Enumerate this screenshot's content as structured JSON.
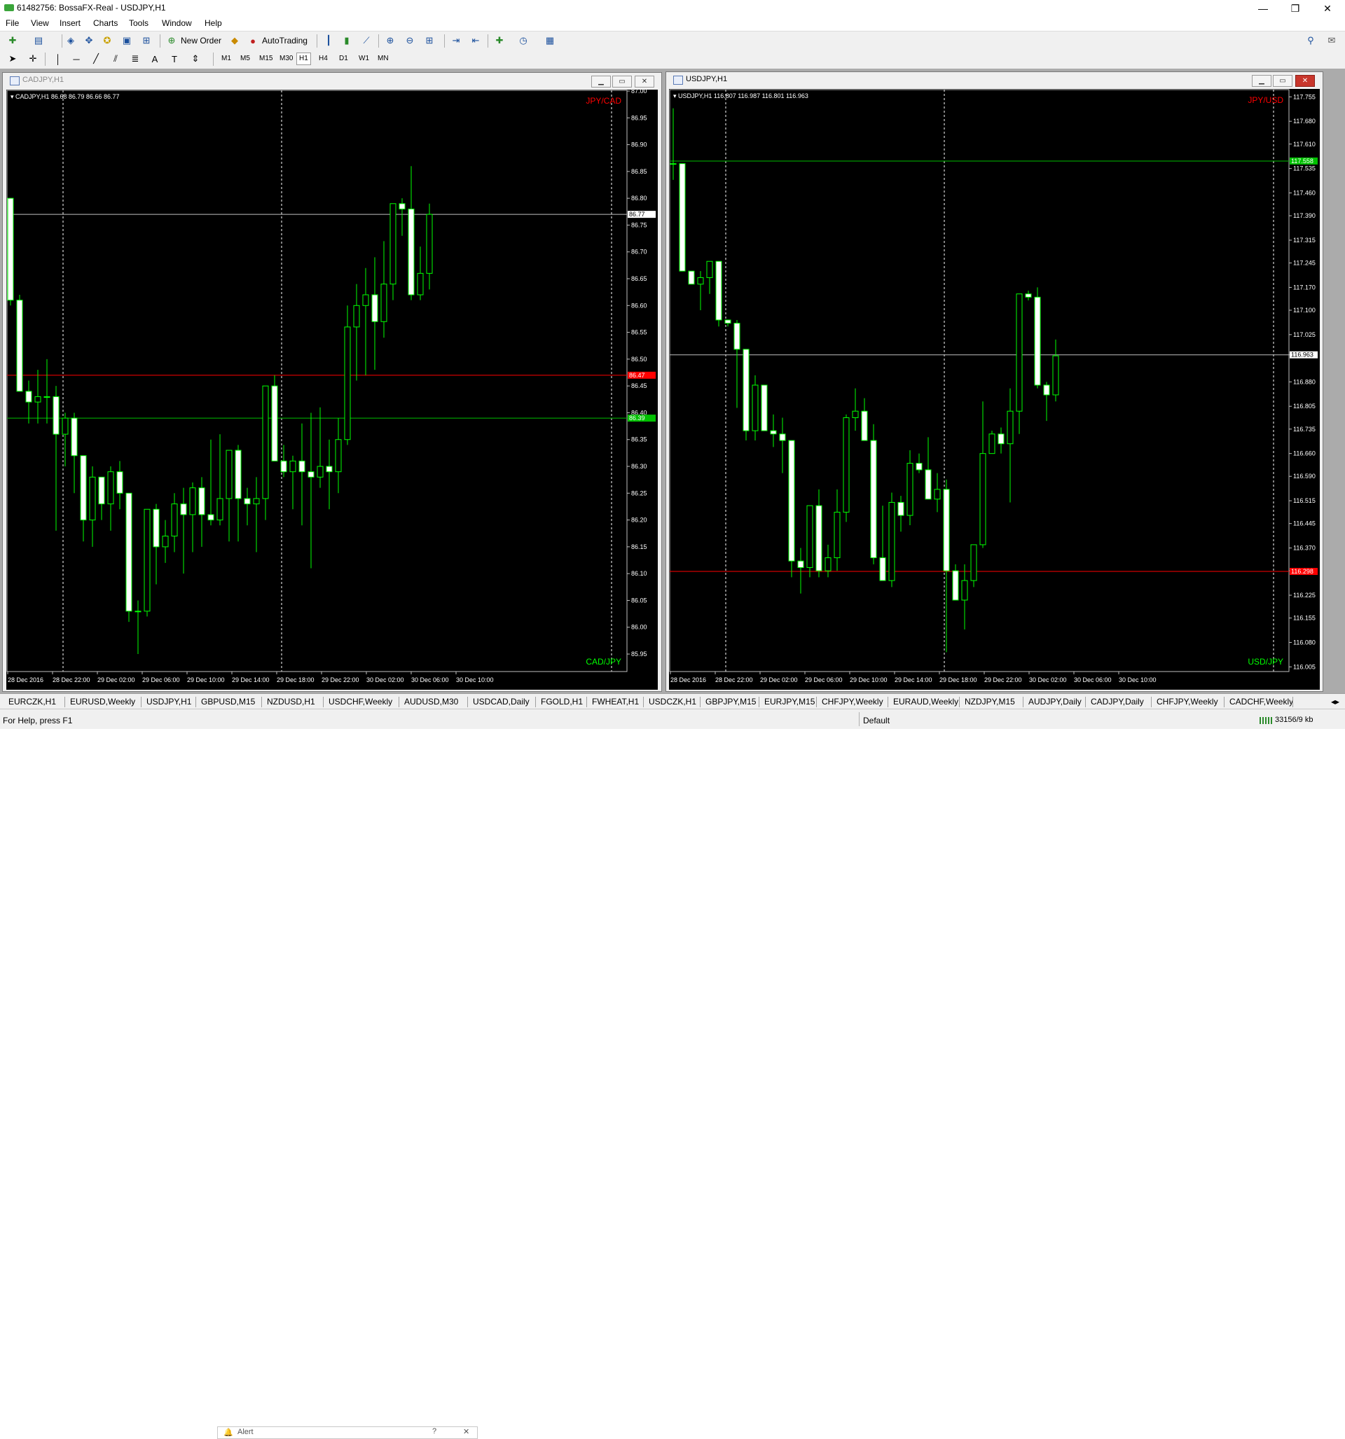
{
  "window": {
    "title": "61482756: BossaFX-Real - USDJPY,H1",
    "minimize": "—",
    "restore": "❐",
    "close": "✕"
  },
  "menu": [
    "File",
    "View",
    "Insert",
    "Charts",
    "Tools",
    "Window",
    "Help"
  ],
  "toolbar": {
    "new_order": "New Order",
    "autotrading": "AutoTrading",
    "timeframes": [
      "M1",
      "M5",
      "M15",
      "M30",
      "H1",
      "H4",
      "D1",
      "W1",
      "MN"
    ],
    "active_timeframe": "H1"
  },
  "charts": [
    {
      "window_title": "CADJPY,H1",
      "info": "CADJPY,H1  86.68 86.79 86.66 86.77",
      "corner_top": "JPY/CAD",
      "corner_bottom": "CAD/JPY",
      "y_min": 85.92,
      "y_max": 87.0,
      "price_labels": [
        "87.00",
        "86.95",
        "86.90",
        "86.85",
        "86.80",
        "86.75",
        "86.70",
        "86.65",
        "86.60",
        "86.55",
        "86.50",
        "86.45",
        "86.40",
        "86.35",
        "86.30",
        "86.25",
        "86.20",
        "86.15",
        "86.10",
        "86.05",
        "86.00",
        "85.95"
      ],
      "hlines": [
        {
          "price": 86.77,
          "label": "86.77",
          "color": "#c0c0c0",
          "tag_bg": "#ffffff",
          "tag_fg": "#000000"
        },
        {
          "price": 86.47,
          "label": "86.47",
          "color": "#ff0000",
          "tag_bg": "#ff0000",
          "tag_fg": "#ffffff"
        },
        {
          "price": 86.39,
          "label": "86.39",
          "color": "#00c000",
          "tag_bg": "#00c000",
          "tag_fg": "#ffffff"
        }
      ],
      "x_labels": [
        "28 Dec 2016",
        "28 Dec 22:00",
        "29 Dec 02:00",
        "29 Dec 06:00",
        "29 Dec 10:00",
        "29 Dec 14:00",
        "29 Dec 18:00",
        "29 Dec 22:00",
        "30 Dec 02:00",
        "30 Dec 06:00",
        "30 Dec 10:00"
      ],
      "day_separators": [
        6,
        30
      ],
      "candles": [
        [
          86.8,
          86.8,
          86.6,
          86.61
        ],
        [
          86.61,
          86.62,
          86.44,
          86.44
        ],
        [
          86.44,
          86.46,
          86.38,
          86.42
        ],
        [
          86.42,
          86.48,
          86.38,
          86.43
        ],
        [
          86.43,
          86.5,
          86.38,
          86.43
        ],
        [
          86.43,
          86.45,
          86.18,
          86.36
        ],
        [
          86.36,
          86.4,
          86.3,
          86.39
        ],
        [
          86.39,
          86.4,
          86.25,
          86.32
        ],
        [
          86.32,
          86.32,
          86.16,
          86.2
        ],
        [
          86.2,
          86.3,
          86.15,
          86.28
        ],
        [
          86.28,
          86.28,
          86.2,
          86.23
        ],
        [
          86.23,
          86.3,
          86.18,
          86.29
        ],
        [
          86.29,
          86.31,
          86.22,
          86.25
        ],
        [
          86.25,
          86.25,
          86.01,
          86.03
        ],
        [
          86.03,
          86.05,
          85.95,
          86.03
        ],
        [
          86.03,
          86.22,
          86.02,
          86.22
        ],
        [
          86.22,
          86.23,
          86.08,
          86.15
        ],
        [
          86.15,
          86.2,
          86.12,
          86.17
        ],
        [
          86.17,
          86.25,
          86.14,
          86.23
        ],
        [
          86.23,
          86.26,
          86.1,
          86.21
        ],
        [
          86.21,
          86.27,
          86.14,
          86.26
        ],
        [
          86.26,
          86.28,
          86.15,
          86.21
        ],
        [
          86.21,
          86.35,
          86.19,
          86.2
        ],
        [
          86.2,
          86.36,
          86.19,
          86.24
        ],
        [
          86.24,
          86.33,
          86.16,
          86.33
        ],
        [
          86.33,
          86.34,
          86.16,
          86.24
        ],
        [
          86.24,
          86.26,
          86.19,
          86.23
        ],
        [
          86.23,
          86.28,
          86.14,
          86.24
        ],
        [
          86.24,
          86.44,
          86.2,
          86.45
        ],
        [
          86.45,
          86.47,
          86.31,
          86.31
        ],
        [
          86.31,
          86.34,
          86.28,
          86.29
        ],
        [
          86.29,
          86.32,
          86.22,
          86.31
        ],
        [
          86.31,
          86.38,
          86.19,
          86.29
        ],
        [
          86.29,
          86.4,
          86.11,
          86.28
        ],
        [
          86.28,
          86.41,
          86.26,
          86.3
        ],
        [
          86.3,
          86.35,
          86.22,
          86.29
        ],
        [
          86.29,
          86.39,
          86.25,
          86.35
        ],
        [
          86.35,
          86.6,
          86.34,
          86.56
        ],
        [
          86.56,
          86.64,
          86.46,
          86.6
        ],
        [
          86.6,
          86.67,
          86.47,
          86.62
        ],
        [
          86.62,
          86.69,
          86.48,
          86.57
        ],
        [
          86.57,
          86.72,
          86.54,
          86.64
        ],
        [
          86.64,
          86.79,
          86.61,
          86.79
        ],
        [
          86.79,
          86.8,
          86.73,
          86.78
        ],
        [
          86.78,
          86.86,
          86.61,
          86.62
        ],
        [
          86.62,
          86.71,
          86.61,
          86.66
        ],
        [
          86.66,
          86.79,
          86.63,
          86.77
        ]
      ]
    },
    {
      "window_title": "USDJPY,H1",
      "info": "USDJPY,H1  116.807 116.987 116.801 116.963",
      "corner_top": "JPY/USD",
      "corner_bottom": "USD/JPY",
      "y_min": 115.995,
      "y_max": 117.775,
      "price_labels": [
        "117.755",
        "117.680",
        "117.610",
        "117.535",
        "117.460",
        "117.390",
        "117.315",
        "117.245",
        "117.170",
        "117.100",
        "117.025",
        "116.963",
        "116.880",
        "116.805",
        "116.735",
        "116.660",
        "116.590",
        "116.515",
        "116.445",
        "116.370",
        "116.300",
        "116.225",
        "116.155",
        "116.080",
        "116.005"
      ],
      "hlines": [
        {
          "price": 117.558,
          "label": "117.558",
          "color": "#00c000",
          "tag_bg": "#00c000",
          "tag_fg": "#ffffff"
        },
        {
          "price": 116.963,
          "label": "116.963",
          "color": "#c0c0c0",
          "tag_bg": "#ffffff",
          "tag_fg": "#000000"
        },
        {
          "price": 116.298,
          "label": "116.298",
          "color": "#ff0000",
          "tag_bg": "#ff0000",
          "tag_fg": "#ffffff"
        }
      ],
      "x_labels": [
        "28 Dec 2016",
        "28 Dec 22:00",
        "29 Dec 02:00",
        "29 Dec 06:00",
        "29 Dec 10:00",
        "29 Dec 14:00",
        "29 Dec 18:00",
        "29 Dec 22:00",
        "30 Dec 02:00",
        "30 Dec 06:00",
        "30 Dec 10:00"
      ],
      "day_separators": [
        6,
        30
      ],
      "candles": [
        [
          117.55,
          117.72,
          117.5,
          117.55
        ],
        [
          117.55,
          117.55,
          117.22,
          117.22
        ],
        [
          117.22,
          117.22,
          117.18,
          117.18
        ],
        [
          117.18,
          117.22,
          117.1,
          117.2
        ],
        [
          117.2,
          117.25,
          117.15,
          117.25
        ],
        [
          117.25,
          117.25,
          117.05,
          117.07
        ],
        [
          117.07,
          117.07,
          117.05,
          117.06
        ],
        [
          117.06,
          117.07,
          116.8,
          116.98
        ],
        [
          116.98,
          116.98,
          116.7,
          116.73
        ],
        [
          116.73,
          116.9,
          116.7,
          116.87
        ],
        [
          116.87,
          116.87,
          116.73,
          116.73
        ],
        [
          116.73,
          116.78,
          116.68,
          116.72
        ],
        [
          116.72,
          116.77,
          116.6,
          116.7
        ],
        [
          116.7,
          116.7,
          116.28,
          116.33
        ],
        [
          116.33,
          116.37,
          116.23,
          116.31
        ],
        [
          116.31,
          116.5,
          116.28,
          116.5
        ],
        [
          116.5,
          116.55,
          116.28,
          116.3
        ],
        [
          116.3,
          116.38,
          116.28,
          116.34
        ],
        [
          116.34,
          116.55,
          116.3,
          116.48
        ],
        [
          116.48,
          116.78,
          116.45,
          116.77
        ],
        [
          116.77,
          116.86,
          116.73,
          116.79
        ],
        [
          116.79,
          116.83,
          116.7,
          116.7
        ],
        [
          116.7,
          116.75,
          116.32,
          116.34
        ],
        [
          116.34,
          116.5,
          116.27,
          116.27
        ],
        [
          116.27,
          116.54,
          116.25,
          116.51
        ],
        [
          116.51,
          116.53,
          116.42,
          116.47
        ],
        [
          116.47,
          116.67,
          116.44,
          116.63
        ],
        [
          116.63,
          116.66,
          116.6,
          116.61
        ],
        [
          116.61,
          116.71,
          116.52,
          116.52
        ],
        [
          116.52,
          116.6,
          116.48,
          116.55
        ],
        [
          116.55,
          116.58,
          116.05,
          116.3
        ],
        [
          116.3,
          116.32,
          116.21,
          116.21
        ],
        [
          116.21,
          116.32,
          116.12,
          116.27
        ],
        [
          116.27,
          116.38,
          116.25,
          116.38
        ],
        [
          116.38,
          116.82,
          116.37,
          116.66
        ],
        [
          116.66,
          116.73,
          116.66,
          116.72
        ],
        [
          116.72,
          116.74,
          116.66,
          116.69
        ],
        [
          116.69,
          116.86,
          116.51,
          116.79
        ],
        [
          116.79,
          117.15,
          116.72,
          117.15
        ],
        [
          117.15,
          117.16,
          117.13,
          117.14
        ],
        [
          117.14,
          117.17,
          116.86,
          116.87
        ],
        [
          116.87,
          116.88,
          116.76,
          116.84
        ],
        [
          116.84,
          117.01,
          116.82,
          116.96
        ]
      ]
    }
  ],
  "tabs": [
    "EURCZK,H1",
    "EURUSD,Weekly",
    "USDJPY,H1",
    "GBPUSD,M15",
    "NZDUSD,H1",
    "USDCHF,Weekly",
    "AUDUSD,M30",
    "USDCAD,Daily",
    "FGOLD,H1",
    "FWHEAT,H1",
    "USDCZK,H1",
    "GBPJPY,M15",
    "EURJPY,M15",
    "CHFJPY,Weekly",
    "EURAUD,Weekly",
    "NZDJPY,M15",
    "AUDJPY,Daily",
    "CADJPY,Daily",
    "CHFJPY,Weekly",
    "CADCHF,Weekly"
  ],
  "status": {
    "help": "For Help, press F1",
    "profile": "Default",
    "traffic": "33156/9 kb",
    "alert": "Alert"
  }
}
